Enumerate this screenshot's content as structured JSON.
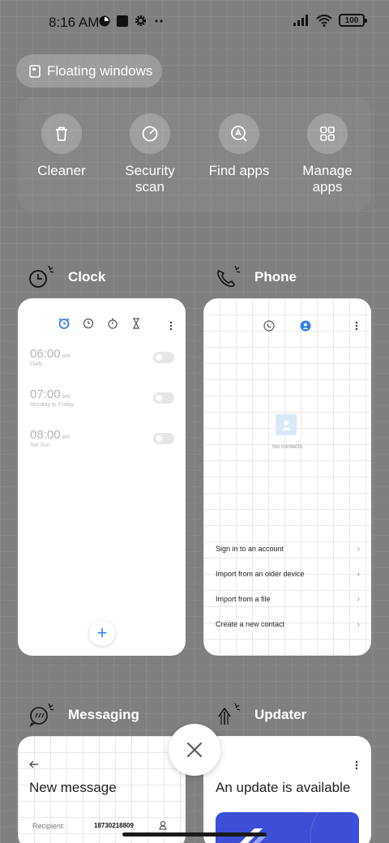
{
  "status": {
    "time": "8:16 AM",
    "battery": "100"
  },
  "floating": {
    "label": "Floating windows"
  },
  "tools": [
    {
      "label": "Cleaner",
      "icon": "trash-icon"
    },
    {
      "label": "Security scan",
      "icon": "shield-scan-icon"
    },
    {
      "label": "Find apps",
      "icon": "find-apps-icon"
    },
    {
      "label": "Manage apps",
      "icon": "grid-icon"
    }
  ],
  "apps": {
    "clock": {
      "name": "Clock",
      "alarms": [
        {
          "time": "06:00",
          "ampm": "am",
          "repeat": "Daily"
        },
        {
          "time": "07:00",
          "ampm": "am",
          "repeat": "Monday to Friday"
        },
        {
          "time": "08:00",
          "ampm": "am",
          "repeat": "Sat Sun"
        }
      ],
      "fab": "+"
    },
    "phone": {
      "name": "Phone",
      "empty": "No contacts",
      "options": [
        "Sign in to an account",
        "Import from an older device",
        "Import from a file",
        "Create a new contact"
      ]
    },
    "messaging": {
      "name": "Messaging",
      "title": "New message",
      "recipient_label": "Recipient:",
      "recipient_value": "18730218809"
    },
    "updater": {
      "name": "Updater",
      "title": "An update is available"
    }
  },
  "colors": {
    "accent": "#2f80ed",
    "overlay": "#7f7f7f"
  }
}
